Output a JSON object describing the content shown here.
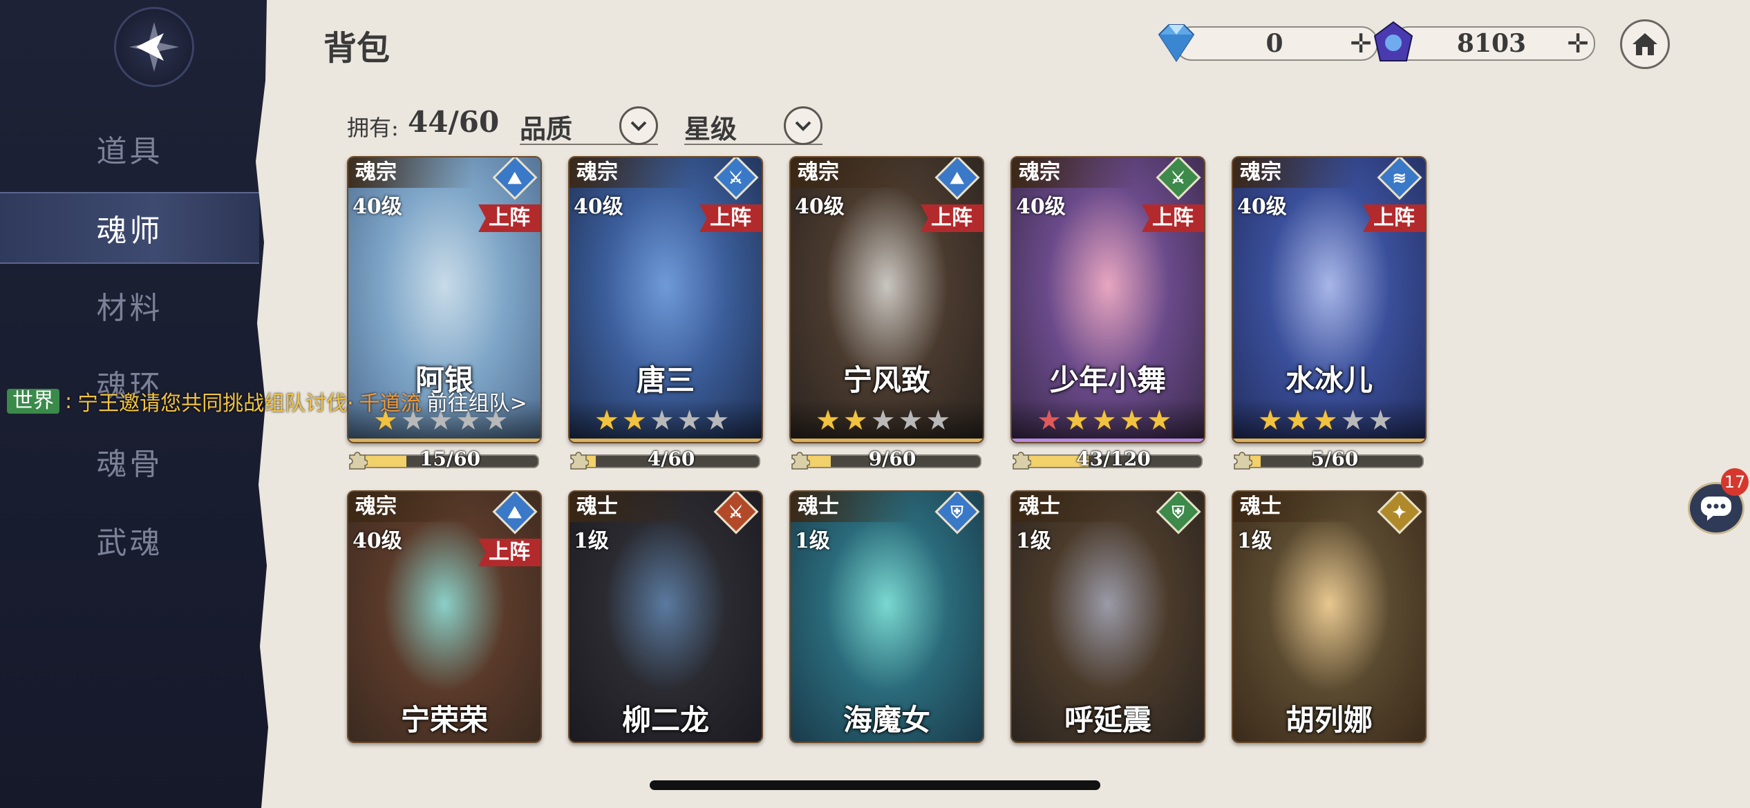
{
  "page_title": "背包",
  "currencies": [
    {
      "name": "diamond",
      "value": "0",
      "icon": "blue-diamond-icon"
    },
    {
      "name": "soul-crystal",
      "value": "8103",
      "icon": "purple-crystal-icon"
    }
  ],
  "nav": {
    "items": [
      {
        "label": "道具",
        "active": false
      },
      {
        "label": "魂师",
        "active": true
      },
      {
        "label": "材料",
        "active": false
      },
      {
        "label": "魂环",
        "active": false
      },
      {
        "label": "魂骨",
        "active": false
      },
      {
        "label": "武魂",
        "active": false
      }
    ]
  },
  "filters": {
    "owned_label": "拥有:",
    "owned_value": "44/60",
    "quality_label": "品质",
    "star_label": "星级"
  },
  "heroes": [
    {
      "rank": "魂宗",
      "level": "40级",
      "deployed": "上阵",
      "name": "阿银",
      "stars": 1,
      "red_star": false,
      "frag": "15/60",
      "frag_pct": 25,
      "element_color": "#3a78c8",
      "element_glyph": "⛰",
      "art": [
        "#7fa6c8",
        "#c8dbe8",
        "#4d6c90"
      ]
    },
    {
      "rank": "魂宗",
      "level": "40级",
      "deployed": "上阵",
      "name": "唐三",
      "stars": 2,
      "red_star": false,
      "frag": "4/60",
      "frag_pct": 7,
      "element_color": "#3a78c8",
      "element_glyph": "⚔",
      "art": [
        "#3b5d9a",
        "#6f9ad8",
        "#1f2f52"
      ]
    },
    {
      "rank": "魂宗",
      "level": "40级",
      "deployed": "上阵",
      "name": "宁风致",
      "stars": 2,
      "red_star": false,
      "frag": "9/60",
      "frag_pct": 15,
      "element_color": "#3a78c8",
      "element_glyph": "⛰",
      "art": [
        "#4a3a2e",
        "#c9c6c0",
        "#2a2420"
      ]
    },
    {
      "rank": "魂宗",
      "level": "40级",
      "deployed": "上阵",
      "name": "少年小舞",
      "stars": 5,
      "red_star": true,
      "frag": "43/120",
      "frag_pct": 36,
      "element_color": "#3d8a4a",
      "element_glyph": "⚔",
      "art": [
        "#6a4a8a",
        "#e8a6c0",
        "#3a2a4a"
      ]
    },
    {
      "rank": "魂宗",
      "level": "40级",
      "deployed": "上阵",
      "name": "水冰儿",
      "stars": 3,
      "red_star": false,
      "frag": "5/60",
      "frag_pct": 8,
      "element_color": "#3a78c8",
      "element_glyph": "≋",
      "art": [
        "#3a4f9a",
        "#a8b6e8",
        "#232e60"
      ]
    },
    {
      "rank": "魂宗",
      "level": "40级",
      "deployed": "上阵",
      "name": "宁荣荣",
      "element_color": "#3a78c8",
      "element_glyph": "⛰",
      "art": [
        "#5a3a2a",
        "#8ad0c8",
        "#3a2a20"
      ]
    },
    {
      "rank": "魂士",
      "level": "1级",
      "deployed": "",
      "name": "柳二龙",
      "element_color": "#b24a2a",
      "element_glyph": "⚔",
      "art": [
        "#2a2a30",
        "#5a7aa0",
        "#1a1a20"
      ]
    },
    {
      "rank": "魂士",
      "level": "1级",
      "deployed": "",
      "name": "海魔女",
      "element_color": "#3a78c8",
      "element_glyph": "⛨",
      "art": [
        "#2a6a7a",
        "#7ad8d0",
        "#1a3a4a"
      ]
    },
    {
      "rank": "魂士",
      "level": "1级",
      "deployed": "",
      "name": "呼延震",
      "element_color": "#3d8a4a",
      "element_glyph": "⛨",
      "art": [
        "#4a3a2a",
        "#9a9aa8",
        "#2a2420"
      ]
    },
    {
      "rank": "魂士",
      "level": "1级",
      "deployed": "",
      "name": "胡列娜",
      "element_color": "#b08a2a",
      "element_glyph": "✦",
      "art": [
        "#5a4a30",
        "#e8c890",
        "#3a2a1a"
      ]
    }
  ],
  "chat": {
    "channel": "世界",
    "separator": ":",
    "message_prefix": "宁王邀请您共同挑战组队讨伐·",
    "target": "千道流",
    "action": "前往组队>"
  },
  "chat_badge_count": "17"
}
